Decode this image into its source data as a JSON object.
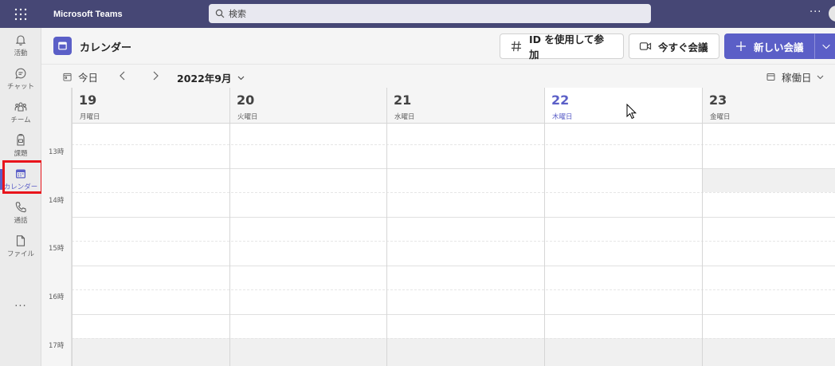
{
  "topbar": {
    "app_title": "Microsoft Teams",
    "search_placeholder": "検索",
    "more": "···"
  },
  "rail": {
    "items": [
      {
        "label": "活動",
        "icon": "bell-icon"
      },
      {
        "label": "チャット",
        "icon": "chat-icon"
      },
      {
        "label": "チーム",
        "icon": "teams-icon"
      },
      {
        "label": "課題",
        "icon": "assignments-icon"
      },
      {
        "label": "カレンダー",
        "icon": "calendar-icon",
        "active": true
      },
      {
        "label": "通話",
        "icon": "phone-icon"
      },
      {
        "label": "ファイル",
        "icon": "file-icon"
      }
    ],
    "more": "···"
  },
  "header": {
    "title": "カレンダー",
    "join_label": "ID を使用して参加",
    "meet_label": "今すぐ会議",
    "new_label": "新しい会議"
  },
  "toolbar": {
    "today_label": "今日",
    "month_label": "2022年9月",
    "view_label": "稼働日"
  },
  "calendar": {
    "days": [
      {
        "num": "19",
        "name": "月曜日"
      },
      {
        "num": "20",
        "name": "火曜日"
      },
      {
        "num": "21",
        "name": "水曜日"
      },
      {
        "num": "22",
        "name": "木曜日",
        "today": true
      },
      {
        "num": "23",
        "name": "金曜日"
      }
    ],
    "hours": [
      "13時",
      "14時",
      "15時",
      "16時",
      "17時"
    ]
  },
  "colors": {
    "brand": "#464775",
    "accent": "#5b5fc7",
    "highlight": "#e8141b"
  }
}
